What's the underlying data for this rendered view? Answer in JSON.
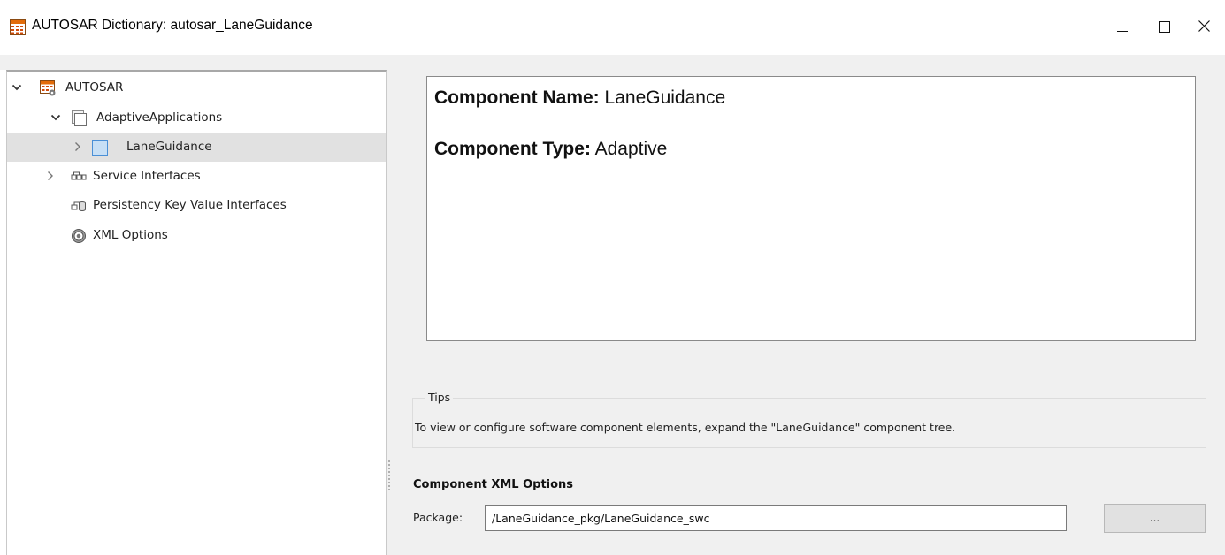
{
  "window": {
    "title": "AUTOSAR Dictionary: autosar_LaneGuidance",
    "minimize_glyph": "—",
    "maximize_glyph": "☐",
    "close_glyph": "✕"
  },
  "tree": {
    "items": [
      {
        "label": "AUTOSAR",
        "icon": "autosar-dictionary-icon",
        "expander": "expanded"
      },
      {
        "label": "AdaptiveApplications",
        "icon": "folder-page-icon",
        "expander": "expanded"
      },
      {
        "label": "LaneGuidance",
        "icon": "component-icon",
        "expander": "collapsed",
        "selected": true
      },
      {
        "label": "Service Interfaces",
        "icon": "service-interface-icon",
        "expander": "collapsed"
      },
      {
        "label": "Persistency Key Value Interfaces",
        "icon": "persistency-interface-icon",
        "expander": "none"
      },
      {
        "label": "XML Options",
        "icon": "gear-icon",
        "expander": "none"
      }
    ]
  },
  "details": {
    "component_name_label": "Component Name:",
    "component_name_value": "LaneGuidance",
    "component_type_label": "Component Type:",
    "component_type_value": "Adaptive"
  },
  "tips": {
    "legend": "Tips",
    "text": "To view or configure software component elements, expand the \"LaneGuidance\" component tree."
  },
  "xml_options": {
    "heading": "Component XML Options",
    "package_label": "Package:",
    "package_value": "/LaneGuidance_pkg/LaneGuidance_swc",
    "browse_label": "..."
  },
  "colors": {
    "selected_row": "#e1e1e1",
    "panel_background": "#f0f0f0",
    "component_icon_fill": "#c7dff5",
    "component_icon_border": "#4a8fd6"
  }
}
